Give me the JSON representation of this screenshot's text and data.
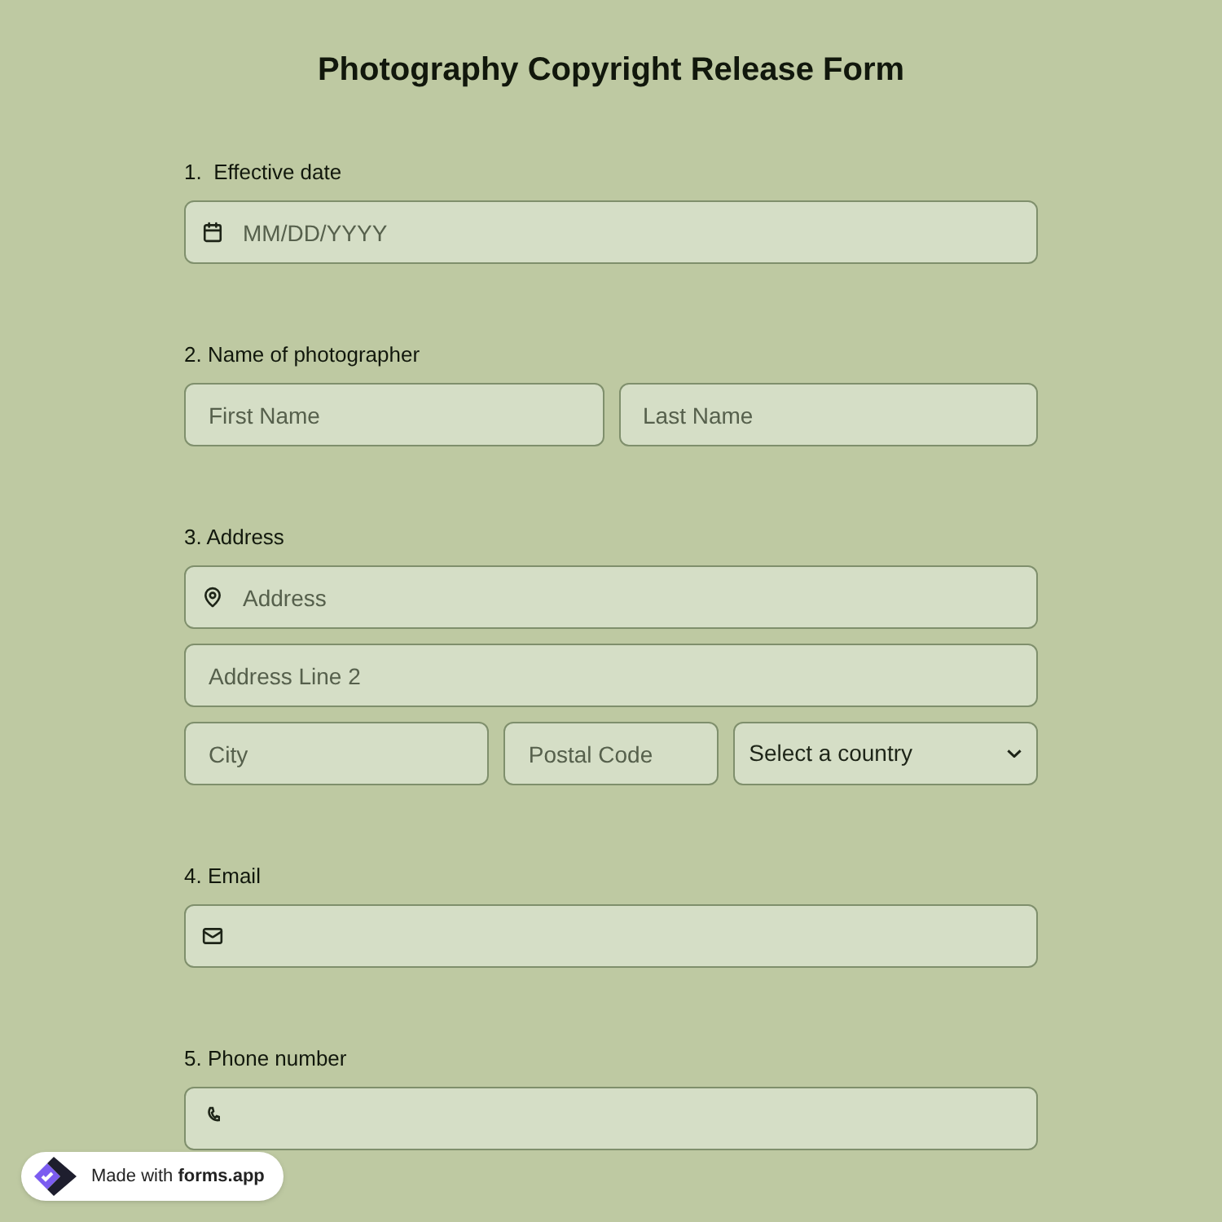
{
  "title": "Photography Copyright Release Form",
  "questions": [
    {
      "label": "1.  Effective date",
      "rows": [
        [
          {
            "kind": "date",
            "placeholder": "MM/DD/YYYY"
          }
        ]
      ]
    },
    {
      "label": "2. Name of photographer",
      "rows": [
        [
          {
            "kind": "text",
            "placeholder": "First Name"
          },
          {
            "kind": "text",
            "placeholder": "Last Name"
          }
        ]
      ]
    },
    {
      "label": "3. Address",
      "rows": [
        [
          {
            "kind": "address",
            "placeholder": "Address"
          }
        ],
        [
          {
            "kind": "text",
            "placeholder": "Address Line 2"
          }
        ],
        [
          {
            "kind": "text",
            "placeholder": "City"
          },
          {
            "kind": "text",
            "placeholder": "Postal Code"
          },
          {
            "kind": "select",
            "value": "Select a country"
          }
        ]
      ]
    },
    {
      "label": "4. Email",
      "rows": [
        [
          {
            "kind": "email"
          }
        ]
      ]
    },
    {
      "label": "5. Phone number",
      "rows": [
        [
          {
            "kind": "phone"
          }
        ]
      ]
    }
  ],
  "badge": {
    "text": "Made with **forms.app**"
  }
}
